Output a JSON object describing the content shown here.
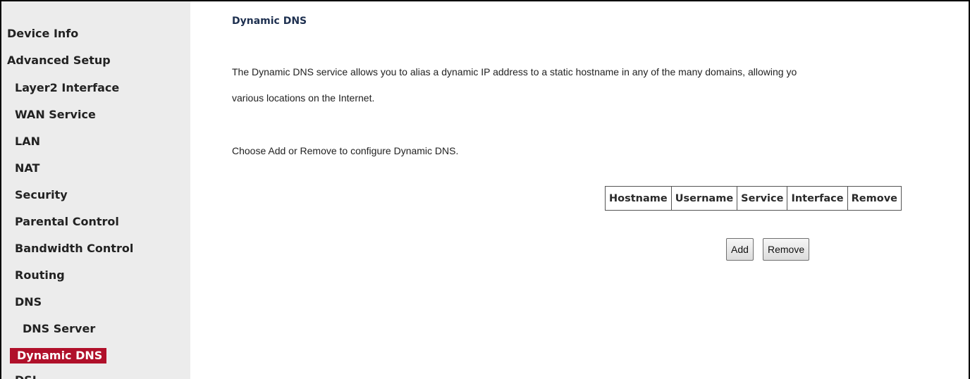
{
  "sidebar": {
    "items": [
      {
        "label": "Device Info"
      },
      {
        "label": "Advanced Setup"
      },
      {
        "label": "Layer2 Interface"
      },
      {
        "label": "WAN Service"
      },
      {
        "label": "LAN"
      },
      {
        "label": "NAT"
      },
      {
        "label": "Security"
      },
      {
        "label": "Parental Control"
      },
      {
        "label": "Bandwidth Control"
      },
      {
        "label": "Routing"
      },
      {
        "label": "DNS"
      },
      {
        "label": "DNS Server"
      },
      {
        "label": "Dynamic DNS"
      },
      {
        "label": "DSL"
      }
    ],
    "active_color": "#b0102a"
  },
  "main": {
    "title": "Dynamic DNS",
    "description_line1": "The Dynamic DNS service allows you to alias a dynamic IP address to a static hostname in any of the many domains, allowing yo",
    "description_line2": "various locations on the Internet.",
    "instruction": "Choose Add or Remove to configure Dynamic DNS.",
    "table": {
      "columns": [
        "Hostname",
        "Username",
        "Service",
        "Interface",
        "Remove"
      ]
    },
    "buttons": {
      "add_label": "Add",
      "remove_label": "Remove"
    }
  }
}
